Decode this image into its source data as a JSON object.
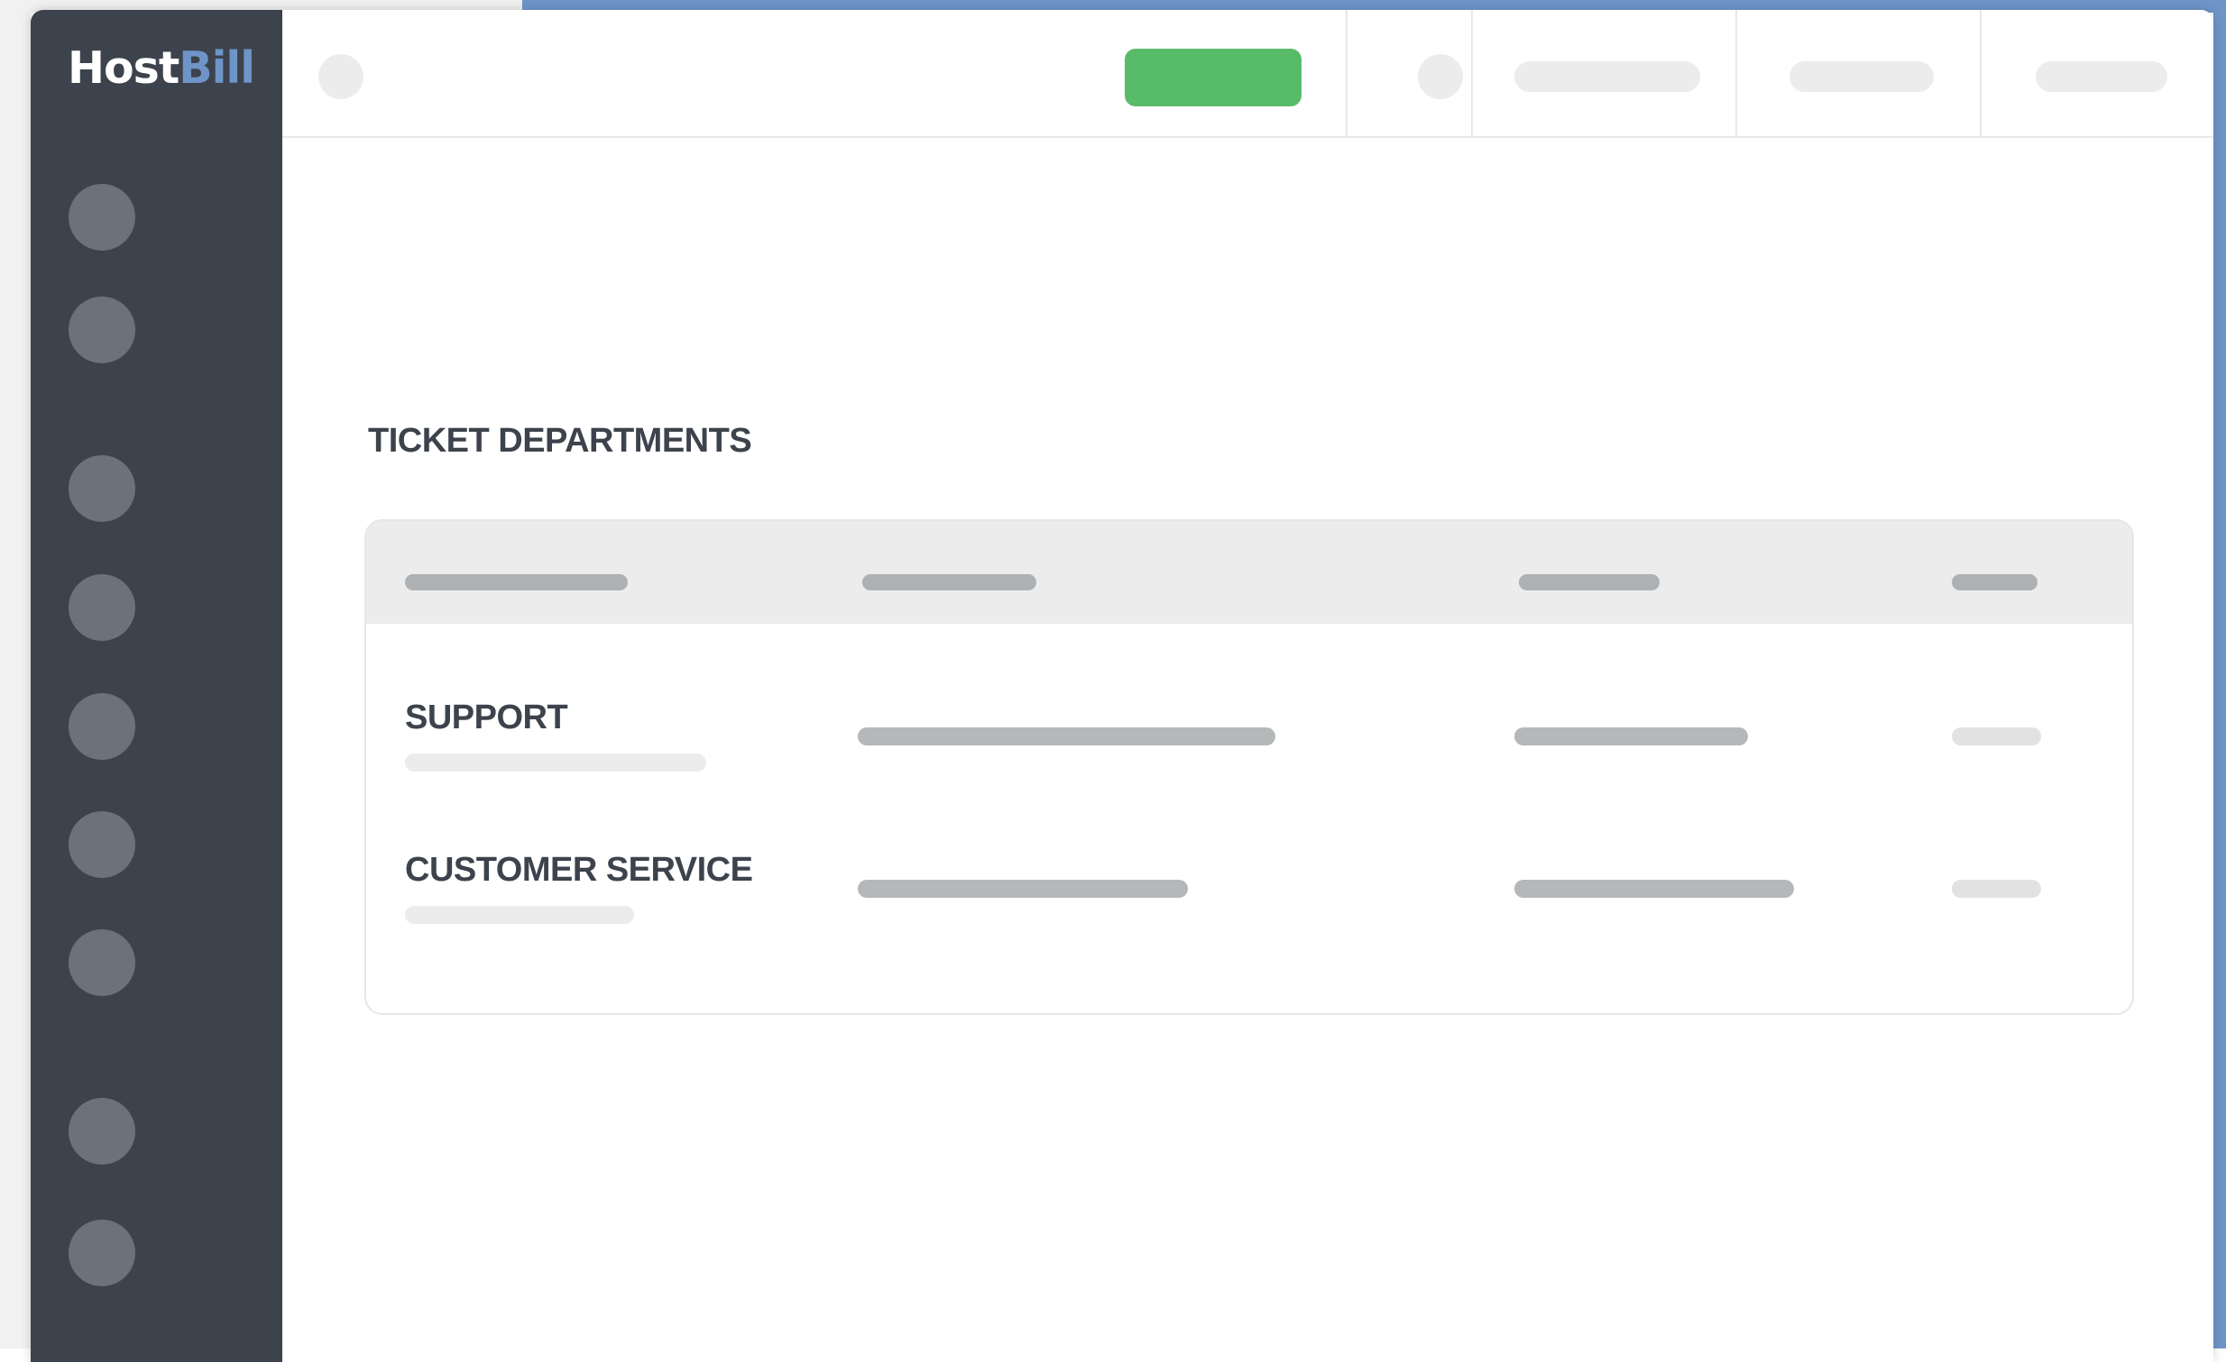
{
  "app": {
    "logo_part1": "Host",
    "logo_part2": "Bill",
    "brand_color": "#6f95c8",
    "accent_green": "#58bb68"
  },
  "sidebar": {
    "nav_item_count": 9
  },
  "main": {
    "section_title": "TICKET DEPARTMENTS",
    "departments": [
      {
        "name": "SUPPORT"
      },
      {
        "name": "CUSTOMER SERVICE"
      }
    ]
  }
}
